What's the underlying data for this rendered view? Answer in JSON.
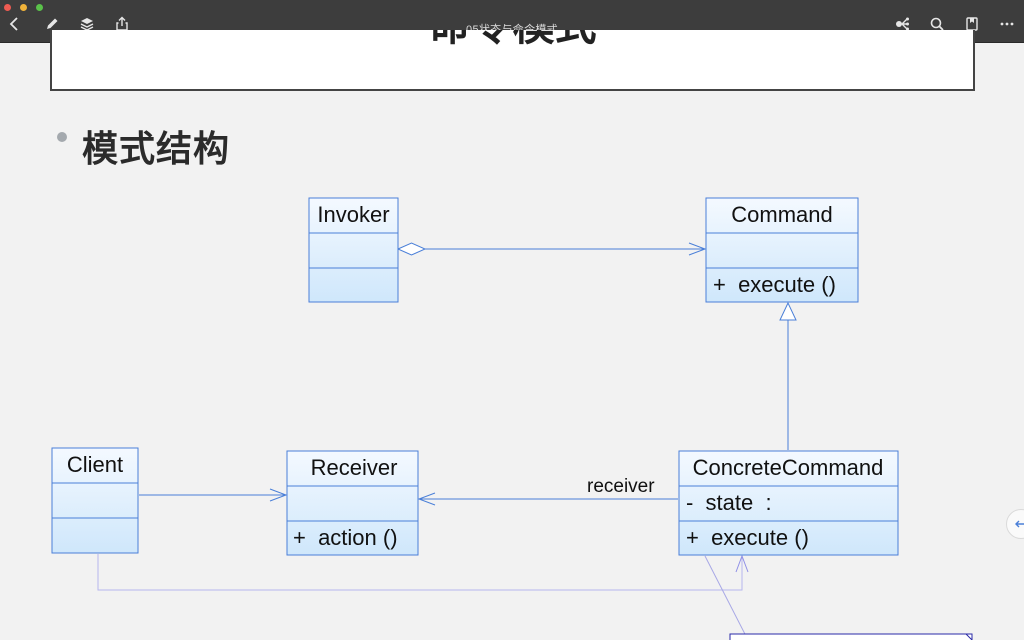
{
  "window": {
    "title": "05状态与命令模式",
    "traffic_colors": [
      "#ee5b52",
      "#f0b33a",
      "#5ac24a"
    ],
    "toolbar_left": [
      "back-icon",
      "pencil-icon",
      "layers-icon",
      "share-icon"
    ],
    "toolbar_right": [
      "mindmap-icon",
      "search-icon",
      "bookmark-icon",
      "more-icon"
    ]
  },
  "slide": {
    "top_title": "命令模式",
    "heading": "模式结构"
  },
  "diagram": {
    "accent": "#4a7fd8",
    "classes": {
      "invoker": {
        "name": "Invoker",
        "attrs": "",
        "ops": ""
      },
      "command": {
        "name": "Command",
        "attrs": "",
        "ops": "+  execute ()"
      },
      "client": {
        "name": "Client",
        "attrs": "",
        "ops": ""
      },
      "receiver": {
        "name": "Receiver",
        "attrs": "",
        "ops": "+  action ()"
      },
      "concrete_command": {
        "name": "ConcreteCommand",
        "attrs": "-  state  :",
        "ops": "+  execute ()"
      }
    },
    "association_label": "receiver"
  },
  "side_button": {
    "icon": "arrow-left-icon"
  }
}
